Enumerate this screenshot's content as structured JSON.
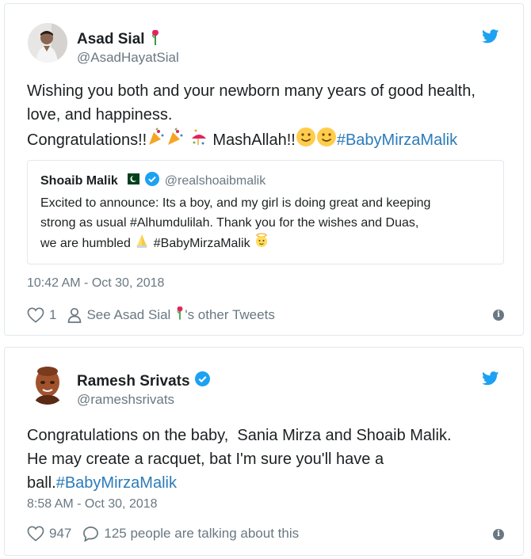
{
  "tweets": [
    {
      "name": "Asad Sial",
      "handle": "@AsadHayatSial",
      "text_lines": [
        "Wishing you both and your newborn many years of good health,",
        "love, and happiness."
      ],
      "congrats_text": "Congratulations!!",
      "mashallah_text": "MashAllah!!",
      "hashtag": "#BabyMirzaMalik",
      "quote": {
        "name": "Shoaib Malik",
        "handle": "@realshoaibmalik",
        "lines": [
          "Excited to announce: Its a boy, and my girl is doing great and keeping",
          "strong as usual #Alhumdulilah. Thank you for the wishes and Duas,"
        ],
        "last_line_prefix": "we are humbled",
        "hashtag": "#BabyMirzaMalik"
      },
      "timestamp": "10:42 AM - Oct 30, 2018",
      "likes": "1",
      "see_prefix": "See Asad Sial",
      "see_suffix": "'s other Tweets"
    },
    {
      "name": "Ramesh Srivats",
      "handle": "@rameshsrivats",
      "text_lines": [
        "Congratulations on the baby,  Sania Mirza and Shoaib Malik.",
        "He may create a racquet, bat I'm sure you'll have a"
      ],
      "last_line_prefix": "ball.",
      "hashtag": "#BabyMirzaMalik",
      "timestamp": "8:58 AM - Oct 30, 2018",
      "likes": "947",
      "talking": "125 people are talking about this"
    }
  ],
  "colors": {
    "link": "#2b7bb9",
    "twitter_blue": "#1da1f2",
    "muted": "#697882",
    "border": "#e1e8ed"
  }
}
